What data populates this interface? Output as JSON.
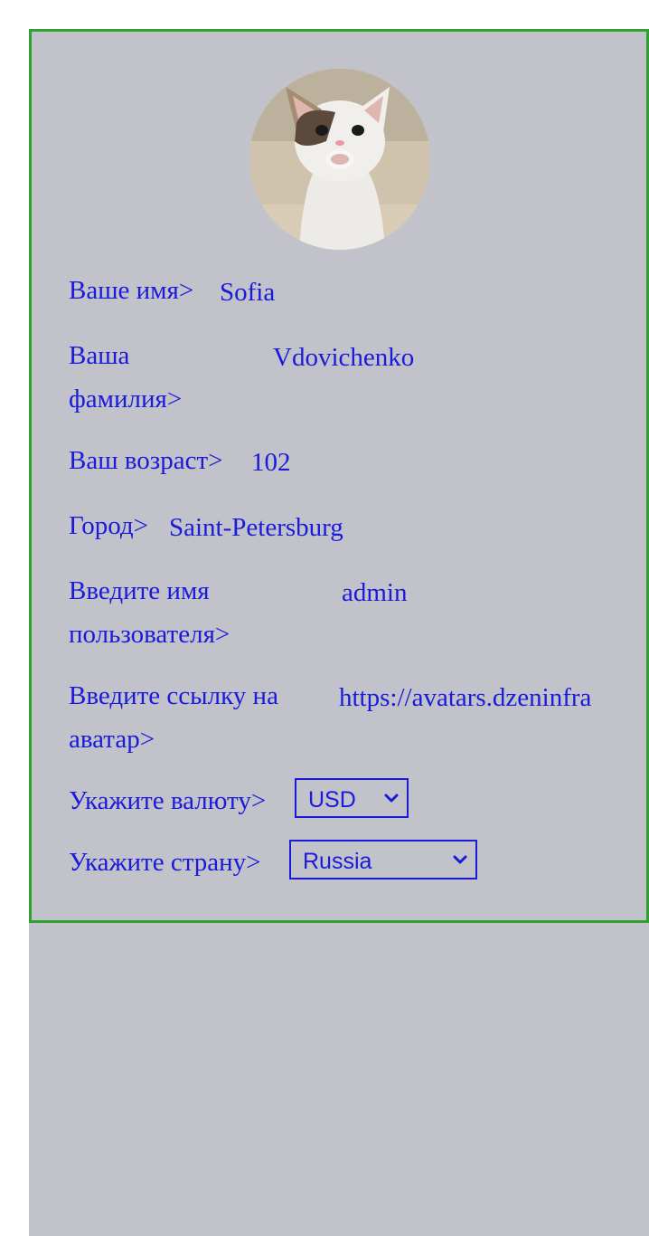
{
  "profile": {
    "avatar_alt": "cat-avatar",
    "fields": [
      {
        "label": "Ваше имя>",
        "value": "Sofia"
      },
      {
        "label": "Ваша фамилия>",
        "value": "Vdovichenko"
      },
      {
        "label": "Ваш возраст>",
        "value": "102"
      },
      {
        "label": "Город>",
        "value": "Saint-Petersburg"
      },
      {
        "label": "Введите имя пользователя>",
        "value": "admin"
      },
      {
        "label": "Введите ссылку на аватар>",
        "value": "https://avatars.dzeninfra"
      }
    ],
    "currency": {
      "label": "Укажите валюту>",
      "selected": "USD"
    },
    "country": {
      "label": "Укажите страну>",
      "selected": "Russia"
    }
  },
  "colors": {
    "text": "#1a1adb",
    "background": "#c2c2ca",
    "border": "#2ea12e"
  }
}
